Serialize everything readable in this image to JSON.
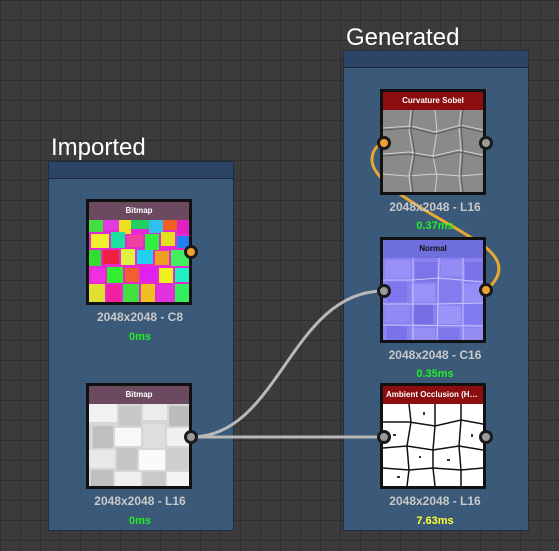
{
  "frames": {
    "imported": {
      "title": "Imported"
    },
    "generated": {
      "title": "Generated"
    }
  },
  "nodes": {
    "bitmap_color": {
      "title": "Bitmap",
      "resolution": "2048x2048 - C8",
      "time": "0ms",
      "header_color": "#6b4a60",
      "time_color": "#22ee22"
    },
    "bitmap_gray": {
      "title": "Bitmap",
      "resolution": "2048x2048 - L16",
      "time": "0ms",
      "header_color": "#6b4a60",
      "time_color": "#22ee22"
    },
    "curvature": {
      "title": "Curvature Sobel",
      "resolution": "2048x2048 - L16",
      "time": "0.37ms",
      "header_color": "#8b0d0d",
      "time_color": "#22ee22"
    },
    "normal": {
      "title": "Normal",
      "resolution": "2048x2048 - C16",
      "time": "0.35ms",
      "header_color": "#6e6edc",
      "time_color": "#22ee22"
    },
    "ambient": {
      "title": "Ambient Occlusion (HB...",
      "resolution": "2048x2048 - L16",
      "time": "7.63ms",
      "header_color": "#8b0d0d",
      "time_color": "#ffff33"
    }
  },
  "colors": {
    "grayscale_port": "#9a9a9a",
    "color_port": "#f0a030",
    "gray_link": "#b8b8b8",
    "color_link": "#e8a830"
  }
}
